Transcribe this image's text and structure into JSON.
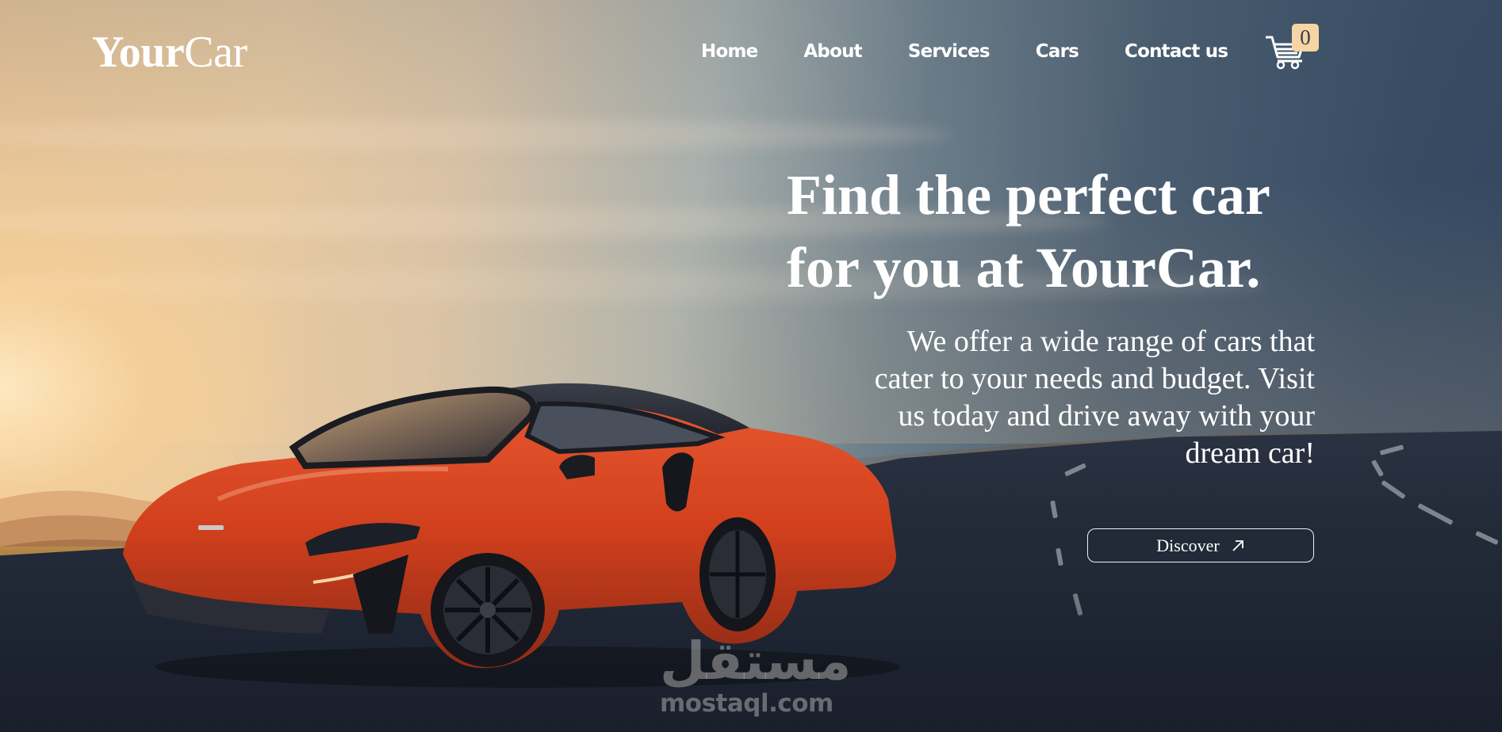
{
  "brand": {
    "logo_bold": "Your",
    "logo_light": "Car"
  },
  "nav": {
    "items": [
      {
        "label": "Home"
      },
      {
        "label": "About"
      },
      {
        "label": "Services"
      },
      {
        "label": "Cars"
      },
      {
        "label": "Contact us"
      }
    ],
    "cart": {
      "icon": "shopping-cart-icon",
      "count": "0"
    }
  },
  "hero": {
    "headline_line1": "Find the perfect car",
    "headline_line2": "for you at YourCar.",
    "description": "We offer a wide range of cars that cater to your needs and budget. Visit us today and drive away with your dream car!",
    "cta": {
      "label": "Discover",
      "icon": "arrow-up-right-icon"
    }
  },
  "watermark": {
    "arabic": "مستقل",
    "latin": "mostaql.com"
  },
  "colors": {
    "badge_bg": "#f7d4a3",
    "badge_text": "#2f3f57",
    "text": "#ffffff",
    "sky_dark": "#33465f",
    "car_body": "#d8401f"
  }
}
